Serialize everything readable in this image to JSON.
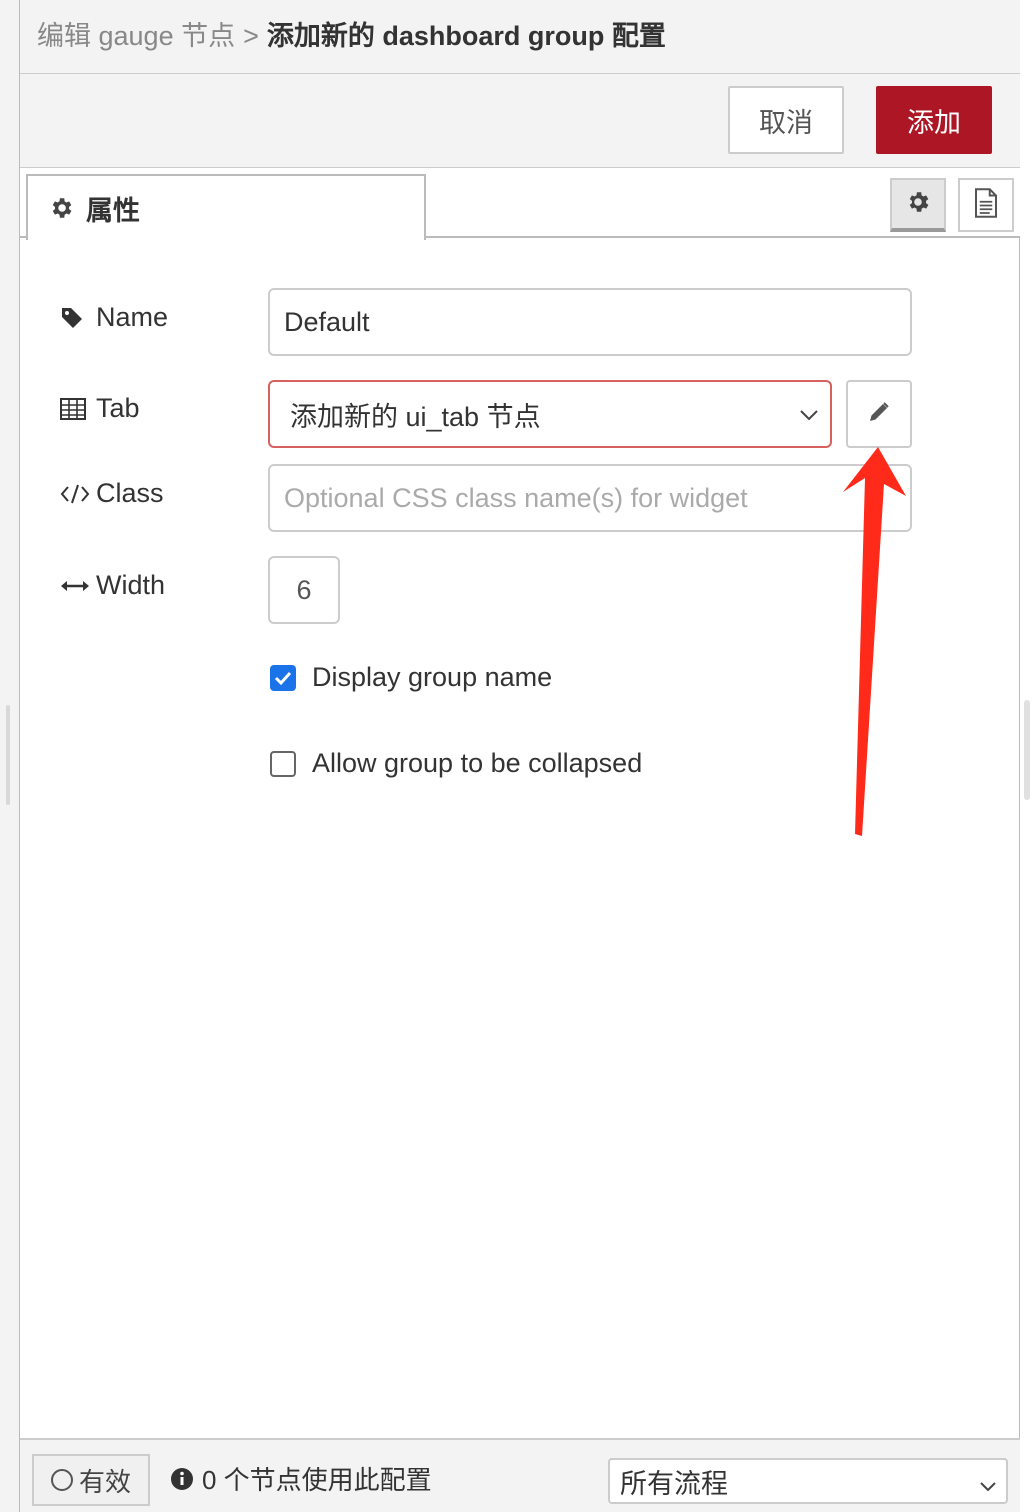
{
  "breadcrumb": {
    "previous": "编辑 gauge 节点",
    "separator": ">",
    "current": "添加新的 dashboard group 配置"
  },
  "toolbar": {
    "cancel_label": "取消",
    "add_label": "添加"
  },
  "tabs": {
    "properties_label": "属性"
  },
  "form": {
    "name_label": "Name",
    "name_value": "Default",
    "tab_label": "Tab",
    "tab_value": "添加新的 ui_tab 节点",
    "class_label": "Class",
    "class_placeholder": "Optional CSS class name(s) for widget",
    "width_label": "Width",
    "width_value": "6",
    "display_group_name_label": "Display group name",
    "display_group_name_checked": true,
    "allow_collapse_label": "Allow group to be collapsed",
    "allow_collapse_checked": false
  },
  "footer": {
    "valid_label": "有效",
    "usage_text": "0 个节点使用此配置",
    "scope_value": "所有流程"
  },
  "colors": {
    "primary_button": "#ad1625",
    "invalid_border": "#d6615f",
    "checkbox_on": "#1a73e8",
    "annotation_arrow": "#ff2a1a"
  },
  "icons": {
    "tab_icon": "gear-icon",
    "settings_button": "gear-icon",
    "description_button": "document-icon",
    "name_icon": "tag-icon",
    "tab_field_icon": "table-icon",
    "class_icon": "code-icon",
    "width_icon": "arrows-horizontal-icon",
    "edit_button": "pencil-icon",
    "usage_icon": "info-circle-icon"
  }
}
